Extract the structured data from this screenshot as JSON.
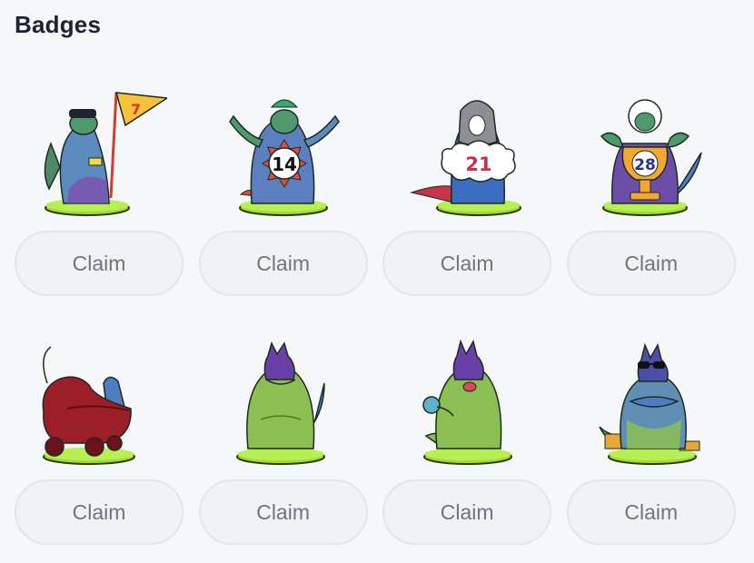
{
  "page": {
    "title": "Badges"
  },
  "badges": [
    {
      "name": "flag-badge",
      "number": "7",
      "claim_label": "Claim"
    },
    {
      "name": "fourteen-badge",
      "number": "14",
      "claim_label": "Claim"
    },
    {
      "name": "hooded-badge",
      "number": "21",
      "claim_label": "Claim"
    },
    {
      "name": "trophy-badge",
      "number": "28",
      "claim_label": "Claim"
    },
    {
      "name": "stroller-badge",
      "number": "",
      "claim_label": "Claim"
    },
    {
      "name": "standing-badge",
      "number": "",
      "claim_label": "Claim"
    },
    {
      "name": "fist-badge",
      "number": "",
      "claim_label": "Claim"
    },
    {
      "name": "sunglasses-badge",
      "number": "",
      "claim_label": "Claim"
    }
  ]
}
